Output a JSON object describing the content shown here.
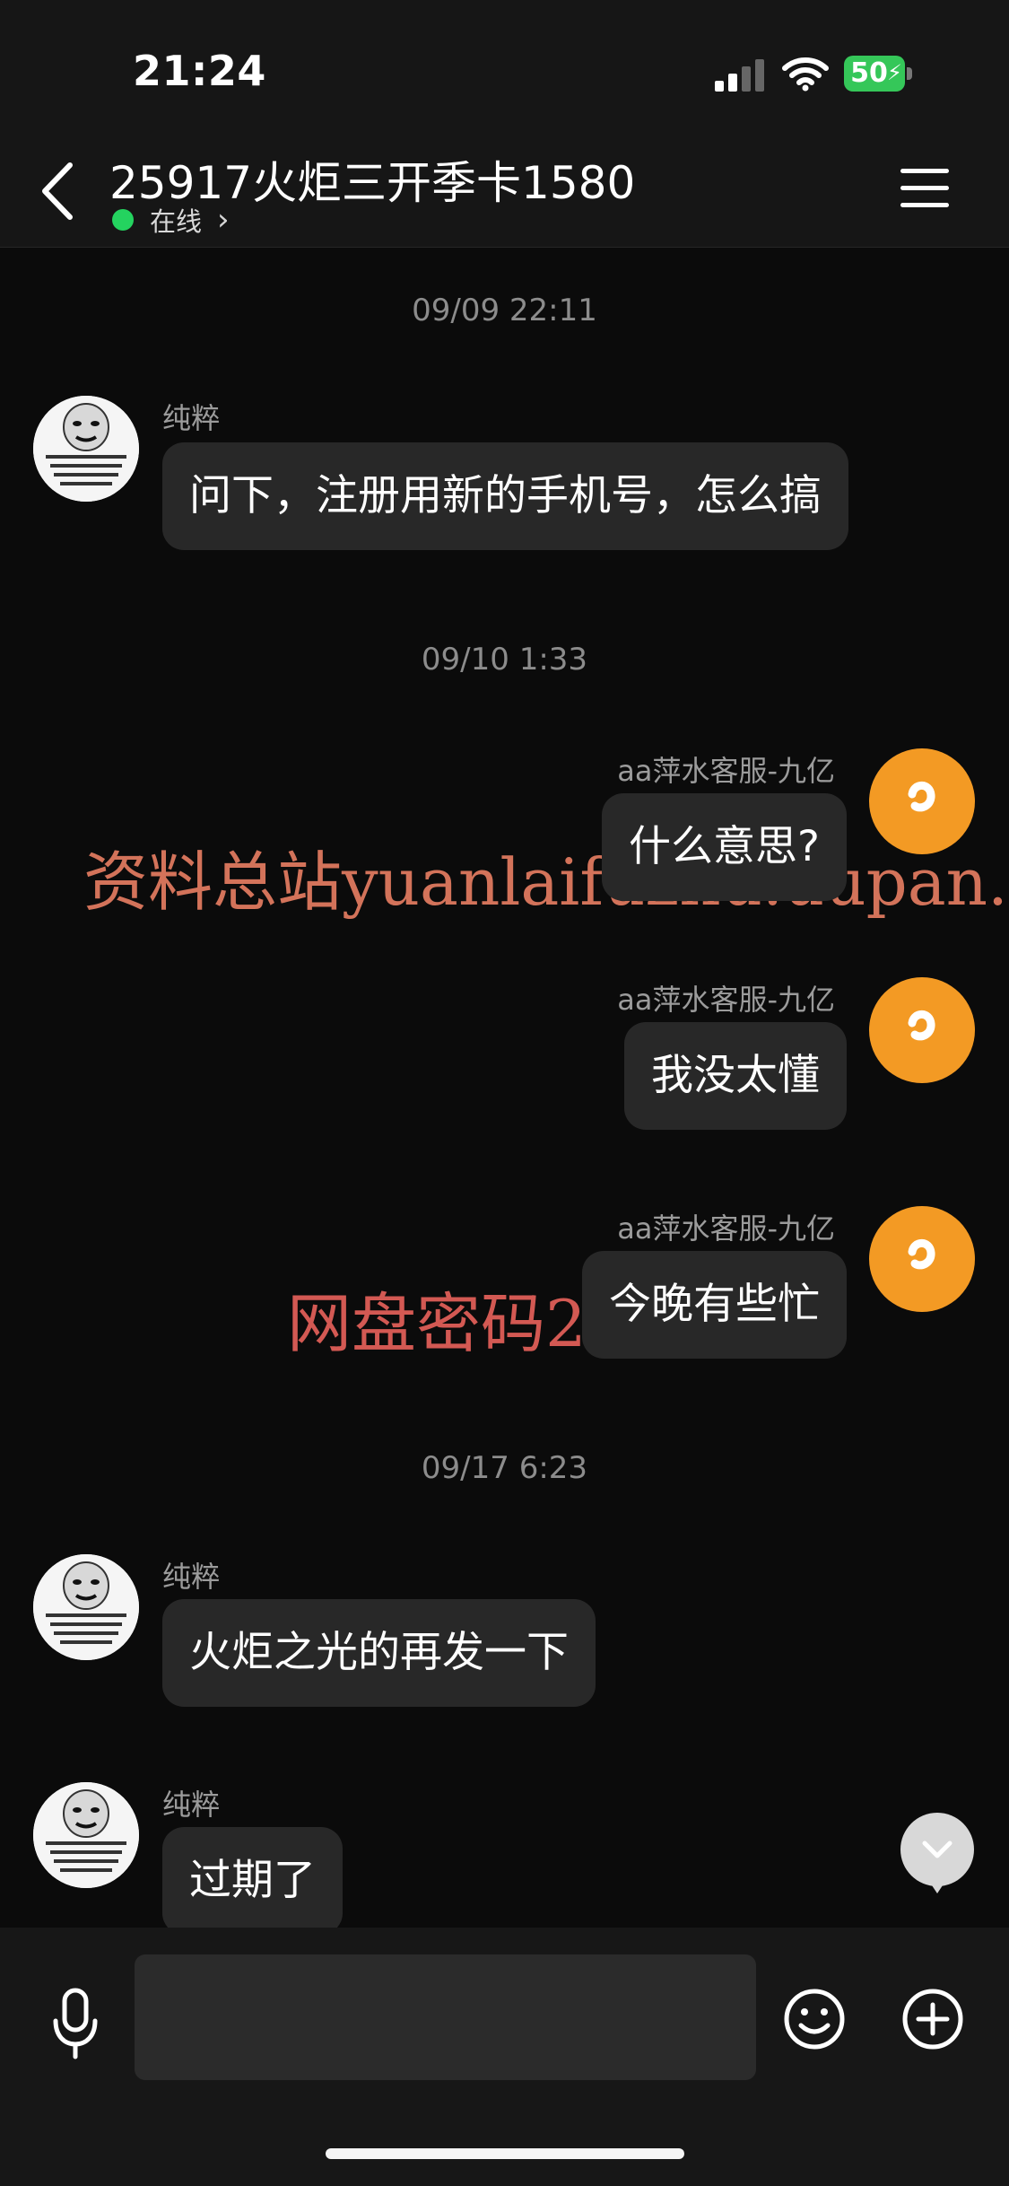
{
  "status_bar": {
    "time": "21:24",
    "battery": "50",
    "battery_color": "#35c759"
  },
  "header": {
    "title": "25917火炬三开季卡1580",
    "status": "在线",
    "back_icon": "chevron-left-icon",
    "menu_icon": "hamburger-menu-icon"
  },
  "messages": [
    {
      "type": "time",
      "text": "09/09 22:11"
    },
    {
      "type": "received",
      "sender": "纯粹",
      "text": "问下，注册用新的手机号，怎么搞"
    },
    {
      "type": "time",
      "text": "09/10 1:33"
    },
    {
      "type": "sent",
      "sender": "aa萍水客服-九亿",
      "text": "什么意思?"
    },
    {
      "type": "sent",
      "sender": "aa萍水客服-九亿",
      "text": "我没太懂"
    },
    {
      "type": "sent",
      "sender": "aa萍水客服-九亿",
      "text": "今晚有些忙"
    },
    {
      "type": "time",
      "text": "09/17 6:23"
    },
    {
      "type": "received",
      "sender": "纯粹",
      "text": "火炬之光的再发一下"
    },
    {
      "type": "received",
      "sender": "纯粹",
      "text": "过期了"
    }
  ],
  "watermarks": [
    "资料总站yuanlaifuzhu.uupan.net",
    "网盘密码2025777"
  ],
  "composer": {
    "input_value": "",
    "input_placeholder": "",
    "mic_icon": "microphone-icon",
    "emoji_icon": "smiley-icon",
    "plus_icon": "plus-circle-icon"
  },
  "colors": {
    "background": "#0b0b0b",
    "bubble": "#282828",
    "online": "#24d35f",
    "agent_avatar": "#f39a24"
  }
}
